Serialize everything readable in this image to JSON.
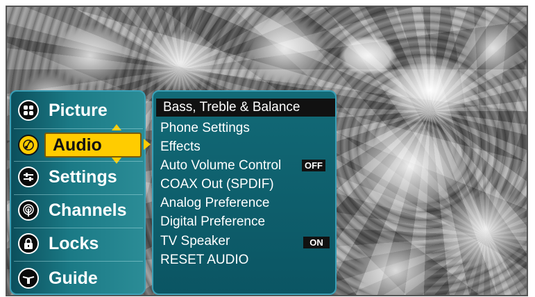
{
  "main_menu": {
    "items": [
      {
        "label": "Picture",
        "icon": "picture-grid-icon"
      },
      {
        "label": "Audio",
        "icon": "audio-note-icon",
        "selected": true
      },
      {
        "label": "Settings",
        "icon": "settings-sliders-icon"
      },
      {
        "label": "Channels",
        "icon": "antenna-icon"
      },
      {
        "label": "Locks",
        "icon": "lock-icon"
      },
      {
        "label": "Guide",
        "icon": "guide-icon"
      }
    ]
  },
  "audio_menu": {
    "items": [
      {
        "label": "Bass, Treble & Balance",
        "highlighted": true
      },
      {
        "label": "Phone Settings"
      },
      {
        "label": "Effects"
      },
      {
        "label": "Auto Volume Control",
        "value": "OFF"
      },
      {
        "label": "COAX Out (SPDIF)"
      },
      {
        "label": "Analog Preference"
      },
      {
        "label": "Digital Preference"
      },
      {
        "label": "TV Speaker",
        "value": "ON"
      },
      {
        "label": "RESET AUDIO"
      }
    ]
  },
  "colors": {
    "accent": "#ffcc00",
    "panel": "#126a77",
    "highlight": "#111111"
  }
}
